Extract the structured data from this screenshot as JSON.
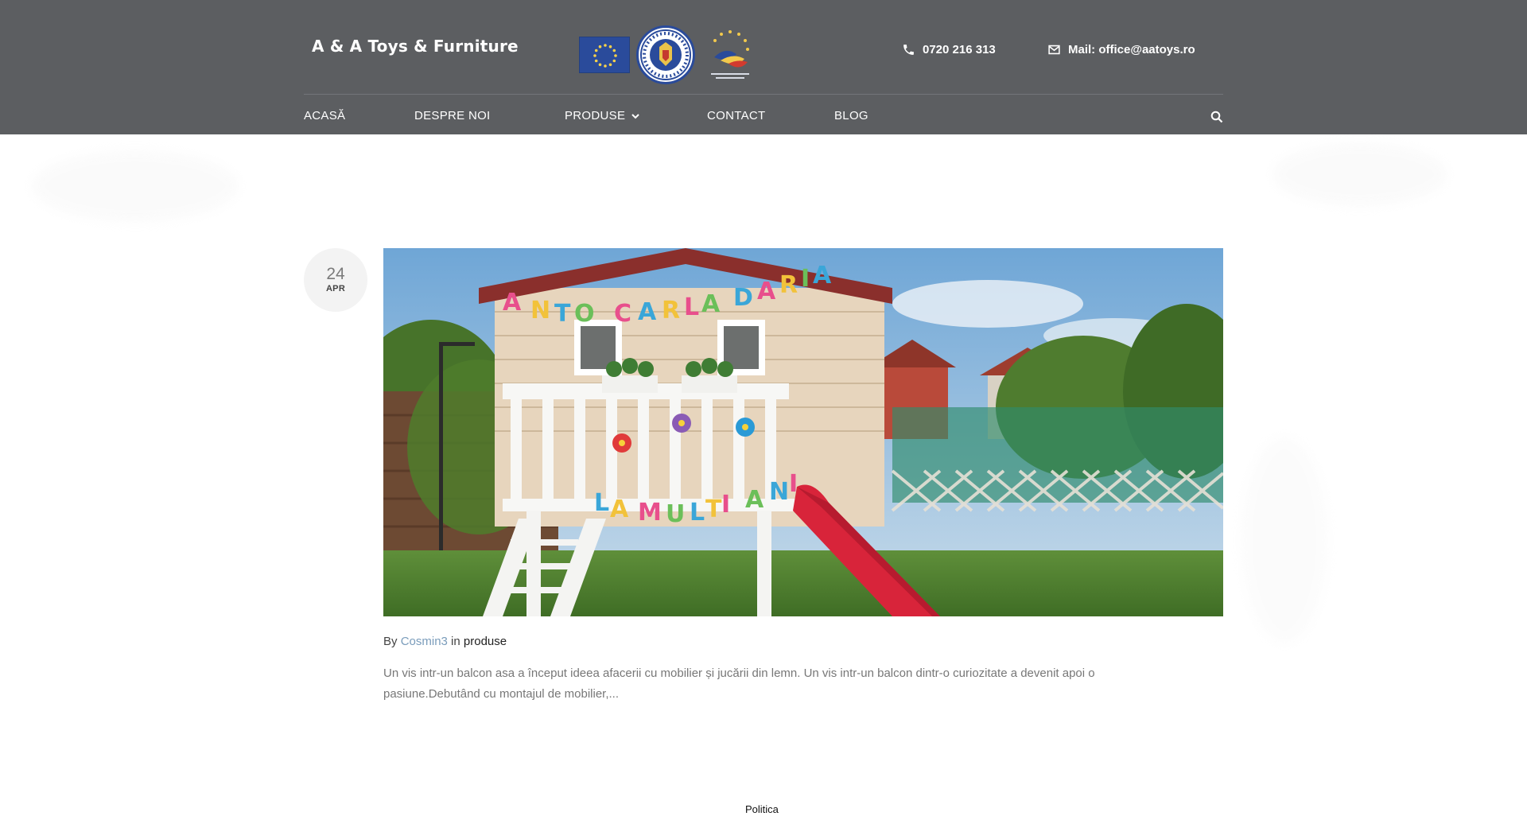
{
  "header": {
    "brand": "A & A Toys & Furniture",
    "phone": "0720 216 313",
    "mail": "Mail: office@aatoys.ro",
    "logos": {
      "eu": "eu-flag-logo",
      "government": "guvernul-romaniei-logo",
      "funding": "fonduri-europene-logo"
    }
  },
  "nav": {
    "items": [
      {
        "label": "ACASĂ"
      },
      {
        "label": "DESPRE NOI"
      },
      {
        "label": "PRODUSE"
      },
      {
        "label": "CONTACT"
      },
      {
        "label": "BLOG"
      }
    ],
    "dropdown_icon": "chevron-down-icon",
    "search_icon": "search-icon"
  },
  "post": {
    "date": {
      "day": "24",
      "month": "APR"
    },
    "image_alt": "Wooden playhouse with slide and birthday garland",
    "meta": {
      "by": "By",
      "author": "Cosmin3",
      "in": "in",
      "category": "produse"
    },
    "excerpt": "Un vis intr-un balcon asa a început ideea afacerii cu mobilier și jucării din lemn. Un vis intr-un balcon dintr-o curiozitate a devenit apoi o pasiune.Debutând cu montajul de mobilier,..."
  },
  "footer": {
    "link": "Politica"
  },
  "colors": {
    "header_bg": "#5c5e61",
    "author_link": "#7a9cbb",
    "badge_bg": "#f3f3f3"
  }
}
